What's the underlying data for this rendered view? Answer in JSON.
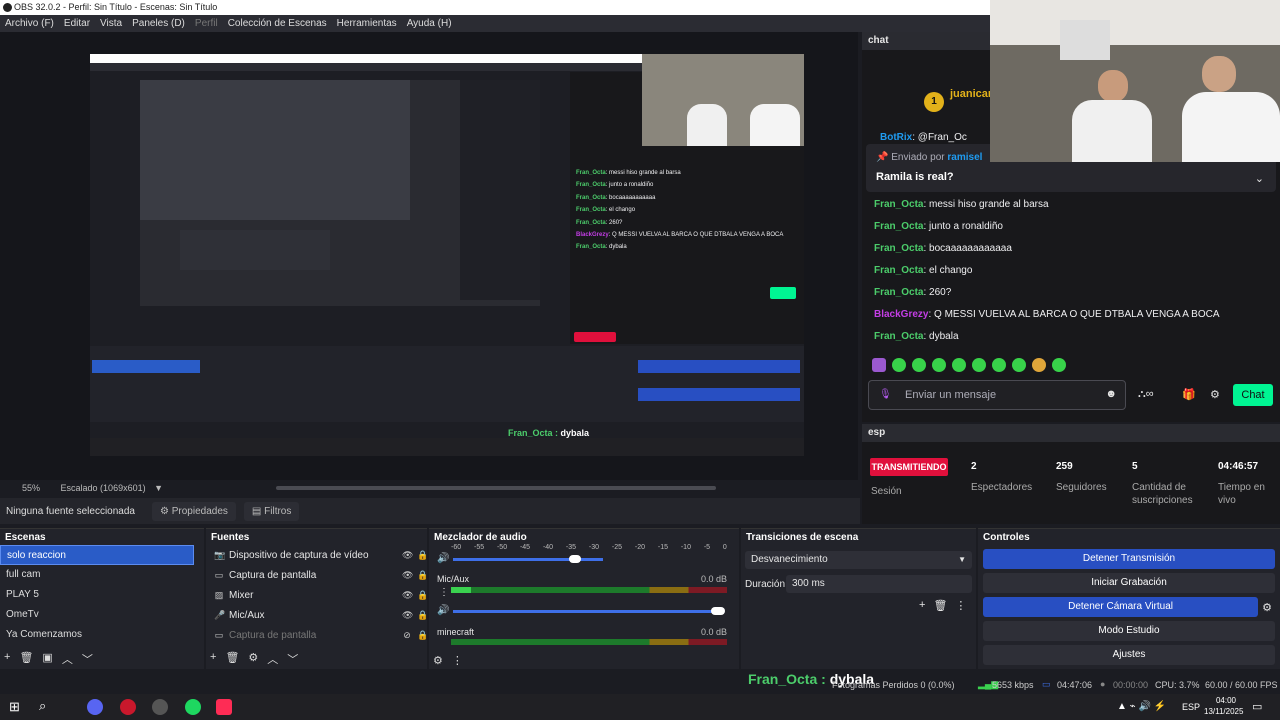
{
  "window": {
    "title": "OBS 32.0.2 - Perfil: Sin Título - Escenas: Sin Título"
  },
  "menu": [
    "Archivo (F)",
    "Editar",
    "Vista",
    "Paneles (D)",
    "Perfil",
    "Colección de Escenas",
    "Herramientas",
    "Ayuda (H)"
  ],
  "preview": {
    "zoom": "55%",
    "scale": "Escalado (1069x601)",
    "nested_caption_user": "Fran_Octa",
    "nested_caption_text": "dybala",
    "nested_chat": [
      {
        "user": "Fran_Octa",
        "text": "messi hiso grande al barsa"
      },
      {
        "user": "Fran_Octa",
        "text": "junto a ronaldiño"
      },
      {
        "user": "Fran_Octa",
        "text": "bocaaaaaaaaaaa"
      },
      {
        "user": "Fran_Octa",
        "text": "el chango"
      },
      {
        "user": "Fran_Octa",
        "text": "260?"
      },
      {
        "user": "BlackGrezy",
        "text": "Q MESSI VUELVA AL BARCA O QUE DTBALA VENGA A BOCA"
      },
      {
        "user": "Fran_Octa",
        "text": "dybala"
      }
    ]
  },
  "props_bar": {
    "no_source": "Ninguna fuente seleccionada",
    "properties": "Propiedades",
    "filters": "Filtros"
  },
  "scenes": {
    "title": "Escenas",
    "items": [
      "solo reaccion",
      "full cam",
      "PLAY 5",
      "OmeTv",
      "Ya Comenzamos"
    ]
  },
  "sources": {
    "title": "Fuentes",
    "items": [
      {
        "label": "Dispositivo de captura de vídeo",
        "icon": "camera-icon"
      },
      {
        "label": "Captura de pantalla",
        "icon": "monitor-icon"
      },
      {
        "label": "Mixer",
        "icon": "image-icon"
      },
      {
        "label": "Mic/Aux",
        "icon": "mic-icon"
      },
      {
        "label": "Captura de pantalla",
        "icon": "monitor-icon"
      }
    ]
  },
  "mixer": {
    "title": "Mezclador de audio",
    "scale": [
      "-60",
      "-55",
      "-50",
      "-45",
      "-40",
      "-35",
      "-30",
      "-25",
      "-20",
      "-15",
      "-10",
      "-5",
      "0"
    ],
    "channels": [
      {
        "name": "Mic/Aux",
        "db": "0.0 dB"
      },
      {
        "name": "minecraft",
        "db": "0.0 dB"
      }
    ]
  },
  "transitions": {
    "title": "Transiciones de escena",
    "selected": "Desvanecimiento",
    "duration_label": "Duración",
    "duration_value": "300 ms"
  },
  "controls": {
    "title": "Controles",
    "buttons": [
      "Detener Transmisión",
      "Iniciar Grabación",
      "Detener Cámara Virtual",
      "Modo Estudio",
      "Ajustes"
    ]
  },
  "chat": {
    "title": "chat",
    "top_user": "juanicar",
    "top_badge": "1",
    "top_partial_user": "BotRix",
    "top_partial_text": "@Fran_Oc",
    "pinned_by": "Enviado por",
    "pinned_user": "ramisel",
    "pinned_msg": "Ramila is real?",
    "messages": [
      {
        "user": "Fran_Octa",
        "text": "messi hiso grande al barsa",
        "color": "#4ccd6b"
      },
      {
        "user": "Fran_Octa",
        "text": "junto a ronaldiño",
        "color": "#4ccd6b"
      },
      {
        "user": "Fran_Octa",
        "text": "bocaaaaaaaaaaaa",
        "color": "#4ccd6b"
      },
      {
        "user": "Fran_Octa",
        "text": "el chango",
        "color": "#4ccd6b"
      },
      {
        "user": "Fran_Octa",
        "text": "260?",
        "color": "#4ccd6b"
      },
      {
        "user": "BlackGrezy",
        "text": "Q MESSI VUELVA AL BARCA O QUE DTBALA VENGA A BOCA",
        "color": "#c43ee6"
      },
      {
        "user": "Fran_Octa",
        "text": "dybala",
        "color": "#4ccd6b"
      }
    ],
    "input_placeholder": "Enviar un mensaje",
    "send_label": "Chat"
  },
  "esp": {
    "title": "esp",
    "status_badge": "TRANSMITIENDO",
    "status_label": "Sesión",
    "viewers": "2",
    "viewers_label": "Espectadores",
    "followers": "259",
    "followers_label": "Seguidores",
    "subs": "5",
    "subs_label": "Cantidad de suscripciones",
    "uptime": "04:46:57",
    "uptime_label": "Tiempo en vivo"
  },
  "caption": {
    "user": "Fran_Octa",
    "text": "dybala"
  },
  "status": {
    "dropped": "Fotogramas Perdidos 0 (0.0%)",
    "bitrate": "5653 kbps",
    "live_time": "04:47:06",
    "rec_time": "00:00:00",
    "cpu": "CPU: 3.7%",
    "fps": "60.00 / 60.00 FPS"
  },
  "taskbar": {
    "lang": "ESP",
    "time": "04:00",
    "date": "13/11/2025"
  },
  "colors": {
    "accent": "#2a5cc7",
    "twitch_green": "#00f593",
    "live_red": "#e0103c"
  }
}
